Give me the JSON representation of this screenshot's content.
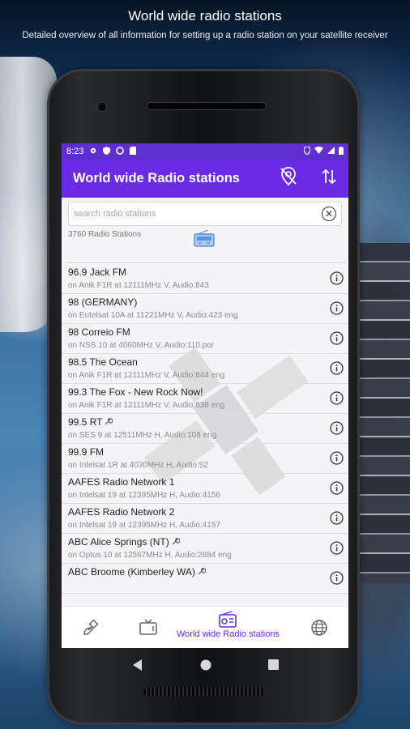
{
  "header": {
    "title": "World wide radio stations",
    "subtitle": "Detailed overview of all information for setting up a radio station on your satellite receiver"
  },
  "status_bar": {
    "time": "8:23"
  },
  "app_bar": {
    "title": "World wide Radio stations",
    "actions": [
      "location-off-icon",
      "sort-icon"
    ]
  },
  "search": {
    "placeholder": "search radio stations",
    "value": ""
  },
  "station_count": "3760 Radio Stations",
  "stations": [
    {
      "name": "96.9 Jack FM",
      "detail": "on Anik F1R at 12111MHz V, Audio:843",
      "tool": false
    },
    {
      "name": "98 (GERMANY)",
      "detail": "on Eutelsat 10A at 11221MHz V, Audio:423 eng",
      "tool": false
    },
    {
      "name": "98 Correio FM",
      "detail": "on NSS 10 at 4060MHz V, Audio:110 por",
      "tool": false
    },
    {
      "name": "98.5 The Ocean",
      "detail": "on Anik F1R at 12111MHz V, Audio:844 eng",
      "tool": false
    },
    {
      "name": "99.3 The Fox - New Rock Now!",
      "detail": "on Anik F1R at 12111MHz V, Audio:838 eng",
      "tool": false
    },
    {
      "name": "99.5 RT",
      "detail": "on SES 9 at 12511MHz H, Audio:108 eng",
      "tool": true
    },
    {
      "name": "99.9 FM",
      "detail": "on Intelsat 1R at 4030MHz H, Audio:52",
      "tool": false
    },
    {
      "name": "AAFES Radio Network 1",
      "detail": "on Intelsat 19 at 12395MHz H, Audio:4156",
      "tool": false
    },
    {
      "name": "AAFES Radio Network 2",
      "detail": "on Intelsat 19 at 12395MHz H, Audio:4157",
      "tool": false
    },
    {
      "name": "ABC Alice Springs (NT)",
      "detail": "on Optus 10 at 12567MHz H, Audio:2884 eng",
      "tool": true
    },
    {
      "name": "ABC Broome (Kimberley WA)",
      "detail": "",
      "tool": true
    }
  ],
  "bottom_nav": {
    "items": [
      {
        "icon": "satellite-icon",
        "label": ""
      },
      {
        "icon": "tv-icon",
        "label": ""
      },
      {
        "icon": "radio-icon",
        "label": "World wide Radio stations"
      },
      {
        "icon": "globe-icon",
        "label": ""
      }
    ],
    "active_index": 2
  },
  "colors": {
    "accent": "#6a2be6",
    "status_bar": "#5f2fd0"
  }
}
